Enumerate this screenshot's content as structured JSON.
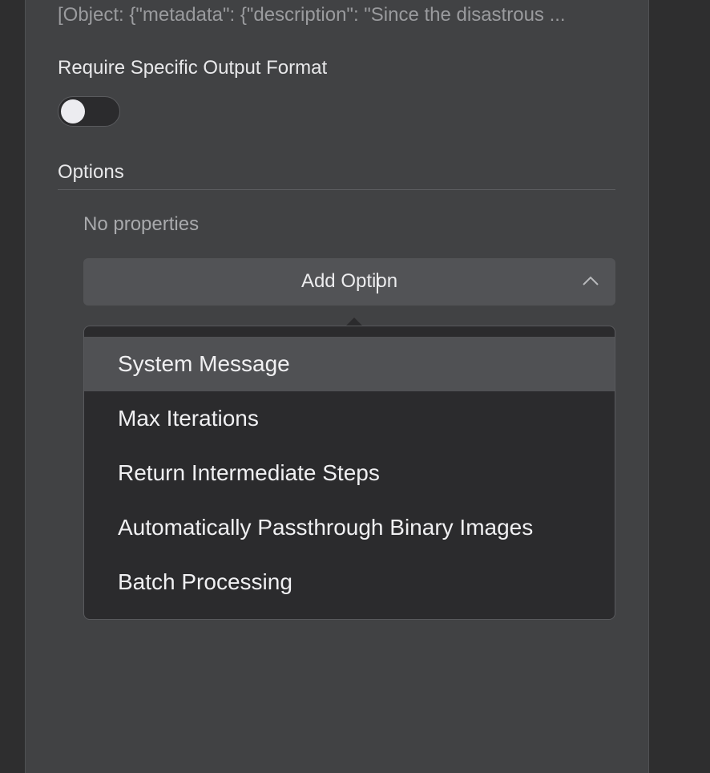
{
  "object_preview": "[Object: {\"metadata\": {\"description\": \"Since the disastrous ...",
  "require_format": {
    "label": "Require Specific Output Format",
    "enabled": false
  },
  "options": {
    "heading": "Options",
    "empty_text": "No properties",
    "add_button_label": "Add Option",
    "add_button_icon": "chevron-up-icon"
  },
  "dropdown": {
    "items": [
      {
        "label": "System Message",
        "highlighted": true
      },
      {
        "label": "Max Iterations",
        "highlighted": false
      },
      {
        "label": "Return Intermediate Steps",
        "highlighted": false
      },
      {
        "label": "Automatically Passthrough Binary Images",
        "highlighted": false
      },
      {
        "label": "Batch Processing",
        "highlighted": false
      }
    ]
  },
  "colors": {
    "panel": "#414244",
    "background": "#2e2e2f",
    "button": "#525356",
    "dropdown": "#2b2b2d",
    "highlight": "#505154"
  }
}
